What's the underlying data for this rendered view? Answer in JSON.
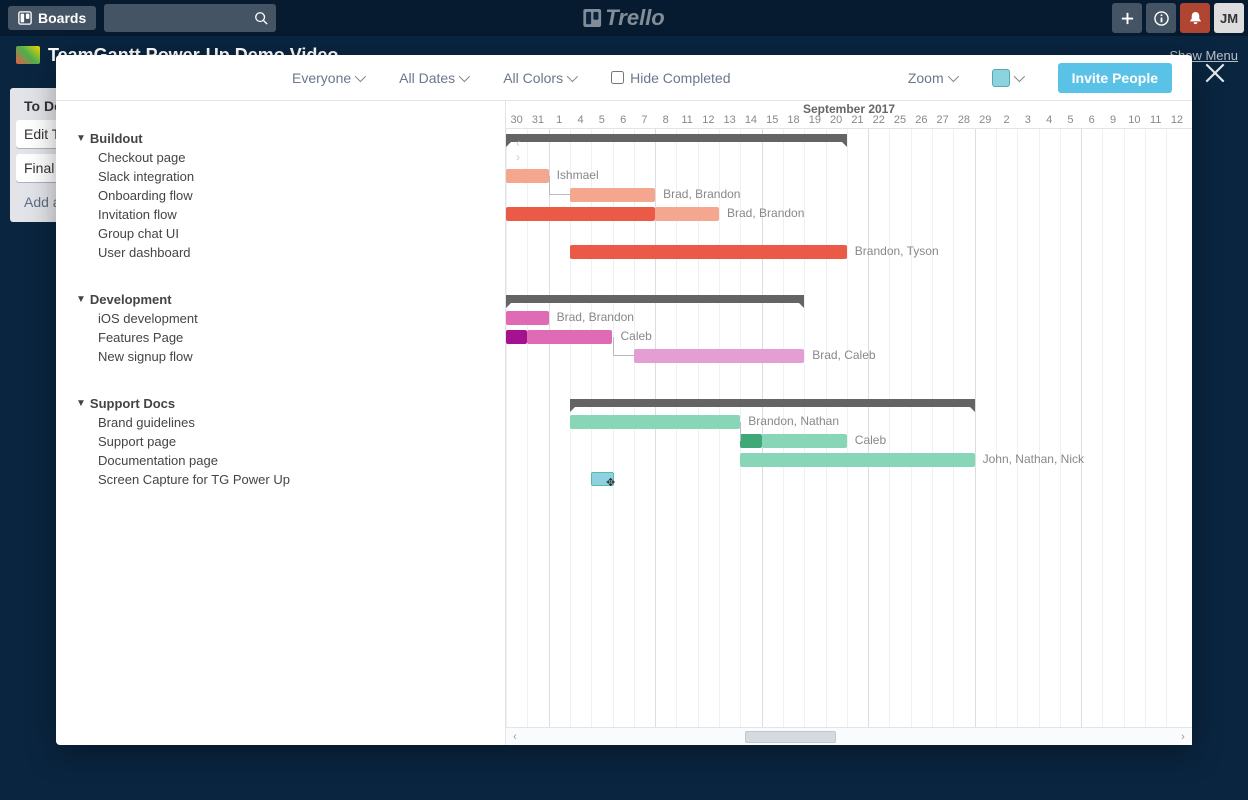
{
  "header": {
    "boards_label": "Boards",
    "logo_text": "Trello",
    "user_initials": "JM",
    "show_menu": "Show Menu"
  },
  "background": {
    "board_title": "TeamGantt Power-Up Demo Video",
    "list_title": "To Do",
    "cards": [
      "Edit T",
      "Final"
    ],
    "add_card": "Add a"
  },
  "toolbar": {
    "everyone": "Everyone",
    "all_dates": "All Dates",
    "all_colors": "All Colors",
    "hide_completed": "Hide Completed",
    "zoom": "Zoom",
    "invite": "Invite People"
  },
  "timeline": {
    "month": "September 2017",
    "days": [
      "30",
      "31",
      "1",
      "4",
      "5",
      "6",
      "7",
      "8",
      "11",
      "12",
      "13",
      "14",
      "15",
      "18",
      "19",
      "20",
      "21",
      "22",
      "25",
      "26",
      "27",
      "28",
      "29",
      "2",
      "3",
      "4",
      "5",
      "6",
      "9",
      "10",
      "11",
      "12"
    ],
    "day_offsets": [
      0,
      1,
      2,
      3,
      4,
      5,
      6,
      7,
      8,
      9,
      10,
      11,
      12,
      13,
      14,
      15,
      16,
      17,
      18,
      19,
      20,
      21,
      22,
      23,
      24,
      25,
      26,
      27,
      28,
      29,
      30,
      31
    ]
  },
  "groups": [
    {
      "name": "Buildout",
      "summary_start": 0,
      "summary_end": 16,
      "tasks": [
        {
          "name": "Checkout page"
        },
        {
          "name": "Slack integration",
          "bars": [
            {
              "start": 0,
              "end": 2,
              "color": "#f5a68f"
            }
          ],
          "label": "Ishmael"
        },
        {
          "name": "Onboarding flow",
          "bars": [
            {
              "start": 3,
              "end": 7,
              "color": "#f5a68f"
            }
          ],
          "label": "Brad, Brandon",
          "conn_from_prev": true
        },
        {
          "name": "Invitation flow",
          "bars": [
            {
              "start": 0,
              "end": 7,
              "color": "#eb5a46"
            },
            {
              "start": 7,
              "end": 10,
              "color": "#f5a68f"
            }
          ],
          "label": "Brad, Brandon"
        },
        {
          "name": "Group chat UI"
        },
        {
          "name": "User dashboard",
          "bars": [
            {
              "start": 3,
              "end": 16,
              "color": "#eb5a46"
            }
          ],
          "label": "Brandon, Tyson"
        }
      ]
    },
    {
      "name": "Development",
      "summary_start": 0,
      "summary_end": 14,
      "tasks": [
        {
          "name": "iOS development",
          "bars": [
            {
              "start": 0,
              "end": 2,
              "color": "#e06bb5"
            }
          ],
          "label": "Brad, Brandon"
        },
        {
          "name": "Features Page",
          "bars": [
            {
              "start": 0,
              "end": 1,
              "color": "#a5128f"
            },
            {
              "start": 1,
              "end": 5,
              "color": "#e06bb5"
            }
          ],
          "label": "Caleb"
        },
        {
          "name": "New signup flow",
          "bars": [
            {
              "start": 6,
              "end": 14,
              "color": "#e49ed3"
            }
          ],
          "label": "Brad, Caleb",
          "conn_from_prev": true
        }
      ]
    },
    {
      "name": "Support Docs",
      "summary_start": 3,
      "summary_end": 22,
      "tasks": [
        {
          "name": "Brand guidelines",
          "bars": [
            {
              "start": 3,
              "end": 11,
              "color": "#87d6b8"
            }
          ],
          "label": "Brandon, Nathan"
        },
        {
          "name": "Support page",
          "bars": [
            {
              "start": 11,
              "end": 12,
              "color": "#3fa877"
            },
            {
              "start": 12,
              "end": 16,
              "color": "#87d6b8"
            }
          ],
          "label": "Caleb",
          "conn_from_prev": true
        },
        {
          "name": "Documentation page",
          "bars": [
            {
              "start": 11,
              "end": 22,
              "color": "#87d6b8"
            }
          ],
          "label": "John, Nathan, Nick"
        },
        {
          "name": "Screen Capture for TG Power Up",
          "drag_at": 4
        }
      ]
    }
  ]
}
